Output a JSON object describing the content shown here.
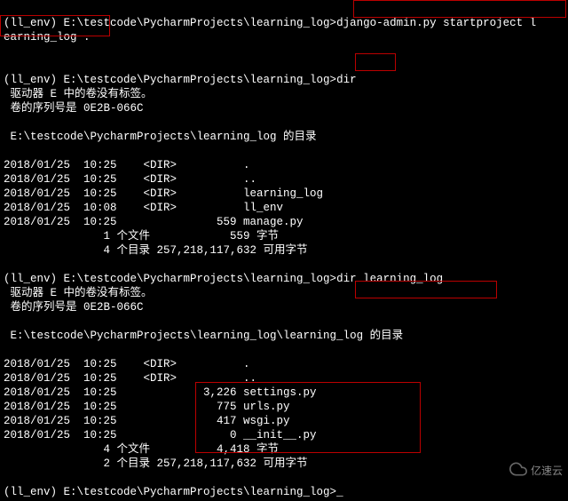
{
  "prompt1": "(ll_env) E:\\testcode\\PycharmProjects\\learning_log>",
  "cmd1": "django-admin.py startproject l",
  "cmd1b": "earning_log .",
  "prompt2": "(ll_env) E:\\testcode\\PycharmProjects\\learning_log>",
  "cmd2": "dir",
  "drive_label": " 驱动器 E 中的卷没有标签。",
  "serial": " 卷的序列号是 0E2B-066C",
  "dir1_header": " E:\\testcode\\PycharmProjects\\learning_log 的目录",
  "dir1_rows": [
    "2018/01/25  10:25    <DIR>          .",
    "2018/01/25  10:25    <DIR>          ..",
    "2018/01/25  10:25    <DIR>          learning_log",
    "2018/01/25  10:08    <DIR>          ll_env",
    "2018/01/25  10:25               559 manage.py"
  ],
  "dir1_sum1": "               1 个文件            559 字节",
  "dir1_sum2": "               4 个目录 257,218,117,632 可用字节",
  "prompt3": "(ll_env) E:\\testcode\\PycharmProjects\\learning_log>",
  "cmd3": "dir learning_log",
  "dir2_header": " E:\\testcode\\PycharmProjects\\learning_log\\learning_log 的目录",
  "dir2_rows": [
    "2018/01/25  10:25    <DIR>          .",
    "2018/01/25  10:25    <DIR>          ..",
    "2018/01/25  10:25             3,226 settings.py",
    "2018/01/25  10:25               775 urls.py",
    "2018/01/25  10:25               417 wsgi.py",
    "2018/01/25  10:25                 0 __init__.py"
  ],
  "dir2_sum1": "               4 个文件          4,418 字节",
  "dir2_sum2": "               2 个目录 257,218,117,632 可用字节",
  "prompt4": "(ll_env) E:\\testcode\\PycharmProjects\\learning_log>",
  "watermark": "亿速云"
}
